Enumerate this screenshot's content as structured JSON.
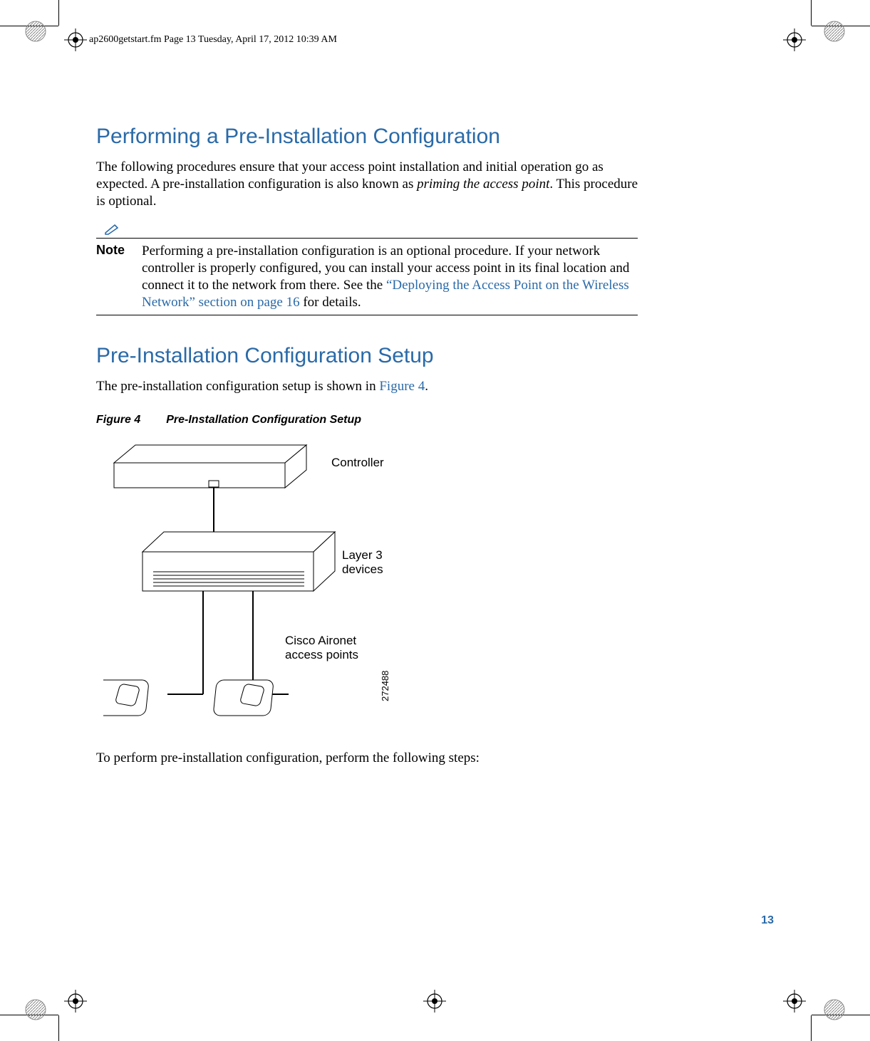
{
  "doc_meta": {
    "header": "ap2600getstart.fm  Page 13  Tuesday, April 17, 2012  10:39 AM"
  },
  "headings": {
    "h1a": "Performing a Pre-Installation Configuration",
    "h1b": "Pre-Installation Configuration Setup"
  },
  "paragraphs": {
    "intro_a": "The following procedures ensure that your access point installation and initial operation go as expected. A pre-installation configuration is also known as ",
    "intro_italic": "priming the access point",
    "intro_b": ". This procedure is optional.",
    "setup_intro_a": "The pre-installation configuration setup is shown in ",
    "setup_intro_link": "Figure 4",
    "setup_intro_b": ".",
    "after_figure": "To perform pre-installation configuration, perform the following steps:"
  },
  "note": {
    "label": "Note",
    "text_a": "Performing a pre-installation configuration is an optional procedure. If your network controller is properly configured, you can install your access point in its final location and connect it to the network from there. See the ",
    "link": "“Deploying the Access Point on the Wireless Network” section on page 16",
    "text_b": " for details."
  },
  "figure": {
    "label": "Figure 4",
    "title": "Pre-Installation Configuration Setup",
    "controller_label": "Controller",
    "layer3_line1": "Layer 3",
    "layer3_line2": "devices",
    "ap_line1": "Cisco Aironet",
    "ap_line2": "access points",
    "ref_number": "272488"
  },
  "page_number": "13",
  "colors": {
    "accent": "#2a6aa8"
  }
}
